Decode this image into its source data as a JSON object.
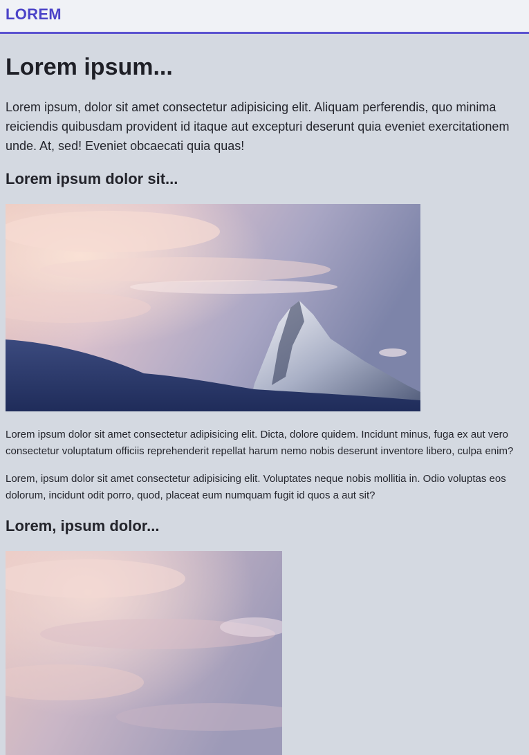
{
  "header": {
    "logo": "LOREM"
  },
  "main": {
    "title": "Lorem ipsum...",
    "intro": "Lorem ipsum, dolor sit amet consectetur adipisicing elit. Aliquam perferendis, quo minima reiciendis quibusdam provident id itaque aut excepturi deserunt quia eveniet exercitationem unde. At, sed! Eveniet obcaecati quia quas!",
    "section1": {
      "heading": "Lorem ipsum dolor sit...",
      "image_icon": "mountain-photo",
      "paragraphs": [
        "Lorem ipsum dolor sit amet consectetur adipisicing elit. Dicta, dolore quidem. Incidunt minus, fuga ex aut vero consectetur voluptatum officiis reprehenderit repellat harum nemo nobis deserunt inventore libero, culpa enim?",
        "Lorem, ipsum dolor sit amet consectetur adipisicing elit. Voluptates neque nobis mollitia in. Odio voluptas eos dolorum, incidunt odit porro, quod, placeat eum numquam fugit id quos a aut sit?"
      ]
    },
    "section2": {
      "heading": "Lorem, ipsum dolor...",
      "image_icon": "sky-photo"
    }
  },
  "colors": {
    "page_background": "#d4d9e1",
    "header_background": "#f0f2f6",
    "accent": "#5a52cf",
    "logo": "#4b43c8",
    "text": "#22232b"
  }
}
